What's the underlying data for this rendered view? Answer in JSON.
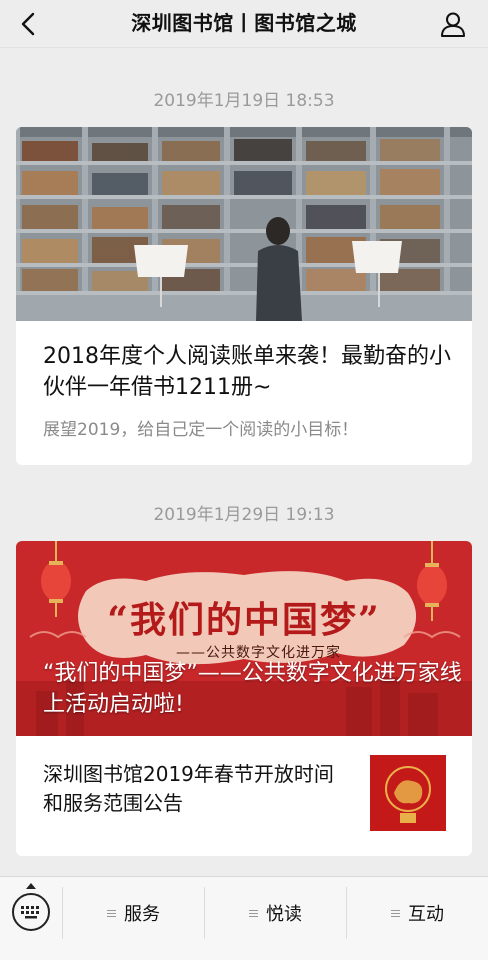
{
  "navbar": {
    "title": "深圳图书馆丨图书馆之城",
    "back_icon": "chevron-left-icon",
    "profile_icon": "user-icon"
  },
  "messages": [
    {
      "timestamp": "2019年1月19日 18:53",
      "article": {
        "title": "2018年度个人阅读账单来袭！最勤奋的小伙伴一年借书1211册~",
        "digest": "展望2019，给自己定一个阅读的小目标！"
      }
    },
    {
      "timestamp": "2019年1月29日 19:13",
      "main_article": {
        "title": "“我们的中国梦”——公共数字文化进万家线上活动启动啦!",
        "cover_calligraphy": "“我们的中国梦”",
        "cover_subtitle": "——公共数字文化进万家"
      },
      "sub_article": {
        "title": "深圳图书馆2019年春节开放时间和服务范围公告"
      }
    }
  ],
  "bottom_menu": {
    "keyboard_icon": "keyboard-icon",
    "items": [
      {
        "label": "服务"
      },
      {
        "label": "悦读"
      },
      {
        "label": "互动"
      }
    ]
  },
  "colors": {
    "background": "#ededed",
    "card": "#ffffff",
    "festival_red": "#c8282a"
  }
}
